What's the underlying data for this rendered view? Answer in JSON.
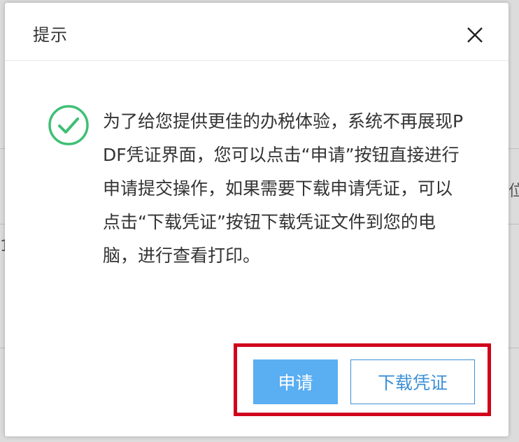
{
  "dialog": {
    "title": "提示",
    "message": "为了给您提供更佳的办税体验，系统不再展现PDF凭证界面，您可以点击“申请”按钮直接进行申请提交操作，如果需要下载申请凭证，可以点击“下载凭证”按钮下载凭证文件到您的电脑，进行查看打印。",
    "icons": {
      "close": "close-icon",
      "status": "check-circle-icon"
    },
    "colors": {
      "success": "#3fbf75",
      "primary": "#5aaef2",
      "highlight": "#d0021b"
    }
  },
  "buttons": {
    "apply_label": "申请",
    "download_label": "下载凭证"
  },
  "background": {
    "fragment_right": "位",
    "fragment_left": "1"
  }
}
